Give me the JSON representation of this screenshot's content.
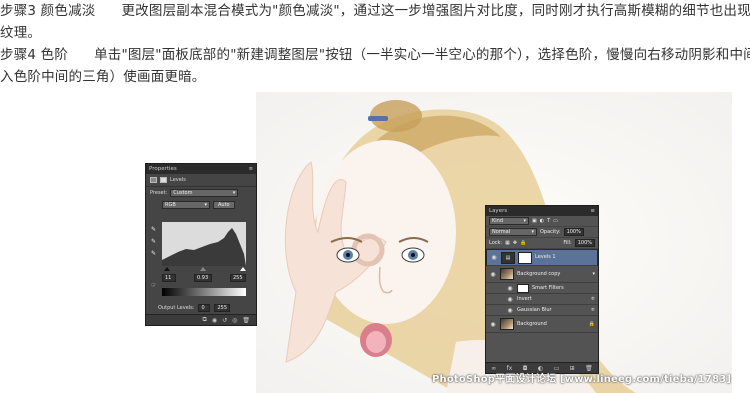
{
  "article": {
    "step3_title": "步骤3 颜色减淡",
    "step3_text": "更改图层副本混合模式为\"颜色减淡\"，通过这一步增强图片对比度，同时刚才执行高斯模糊的细节也出现了颗粒状的",
    "step3_cont": "纹理。",
    "step4_title": "步骤4 色阶",
    "step4_text": "单击\"图层\"面板底部的\"新建调整图层\"按钮（一半实心一半空心的那个），选择色阶，慢慢向右移动阴影和中间调（即输",
    "step4_cont": "入色阶中间的三角）使画面更暗。"
  },
  "properties_panel": {
    "title": "Properties",
    "adjustment_name": "Levels",
    "preset_label": "Preset:",
    "preset_value": "Custom",
    "channel_value": "RGB",
    "auto_label": "Auto",
    "input_black": "11",
    "input_gamma": "0.93",
    "input_white": "255",
    "output_label": "Output Levels:",
    "output_black": "0",
    "output_white": "255"
  },
  "layers_panel": {
    "title": "Layers",
    "filter_kind": "Kind",
    "blend_mode": "Normal",
    "opacity_label": "Opacity:",
    "opacity_value": "100%",
    "lock_label": "Lock:",
    "fill_label": "Fill:",
    "fill_value": "100%",
    "layers": [
      {
        "name": "Levels 1",
        "selected": true
      },
      {
        "name": "Background copy",
        "selected": false
      },
      {
        "name": "Smart Filters",
        "selected": false
      },
      {
        "name": "Invert",
        "selected": false
      },
      {
        "name": "Gaussian Blur",
        "selected": false
      },
      {
        "name": "Background",
        "selected": false
      }
    ]
  },
  "watermark": "PhotoShop平面设计论坛 [www.lineeg.com/tieba/1783]",
  "icons": [
    "eye-icon",
    "eyedropper-icon",
    "lock-icon",
    "trash-icon",
    "new-layer-icon",
    "fx-icon",
    "mask-icon",
    "folder-icon",
    "link-icon"
  ]
}
